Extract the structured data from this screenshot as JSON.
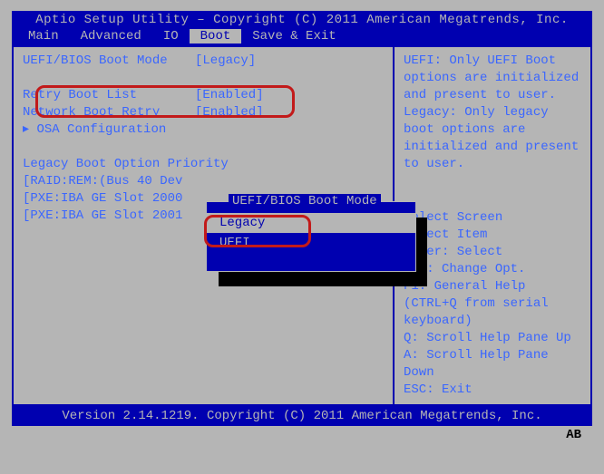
{
  "header": {
    "title": "Aptio Setup Utility – Copyright (C) 2011 American Megatrends, Inc."
  },
  "menubar": {
    "items": [
      {
        "label": "Main"
      },
      {
        "label": "Advanced"
      },
      {
        "label": "IO"
      },
      {
        "label": "Boot"
      },
      {
        "label": "Save & Exit"
      }
    ],
    "active_index": 3
  },
  "left": {
    "boot_mode": {
      "label": "UEFI/BIOS Boot Mode",
      "value": "[Legacy]"
    },
    "retry": {
      "label": "Retry Boot List",
      "value": "[Enabled]"
    },
    "netretry": {
      "label": "Network Boot Retry",
      "value": "[Enabled]"
    },
    "osa": {
      "label": "OSA Configuration"
    },
    "legacy_header": "Legacy Boot Option Priority",
    "legacy": [
      "[RAID:REM:(Bus 40 Dev ",
      "[PXE:IBA GE Slot 2000",
      "[PXE:IBA GE Slot 2001"
    ],
    "popup": {
      "title": "UEFI/BIOS Boot Mode",
      "options": [
        "Legacy",
        "UEFI"
      ],
      "selected_index": 0
    }
  },
  "right": {
    "help": "UEFI: Only UEFI Boot options are initialized and present to user.\nLegacy: Only legacy boot options are initialized and present to user.",
    "keys": "      Select Screen\n      Select Item\nEnter: Select\n+/-: Change Opt.\nF1: General Help\n(CTRL+Q from serial keyboard)\nQ: Scroll Help Pane Up\nA: Scroll Help Pane Down\nESC: Exit"
  },
  "footer": {
    "version": "Version 2.14.1219. Copyright (C) 2011 American Megatrends, Inc."
  },
  "corner_badge": "AB"
}
